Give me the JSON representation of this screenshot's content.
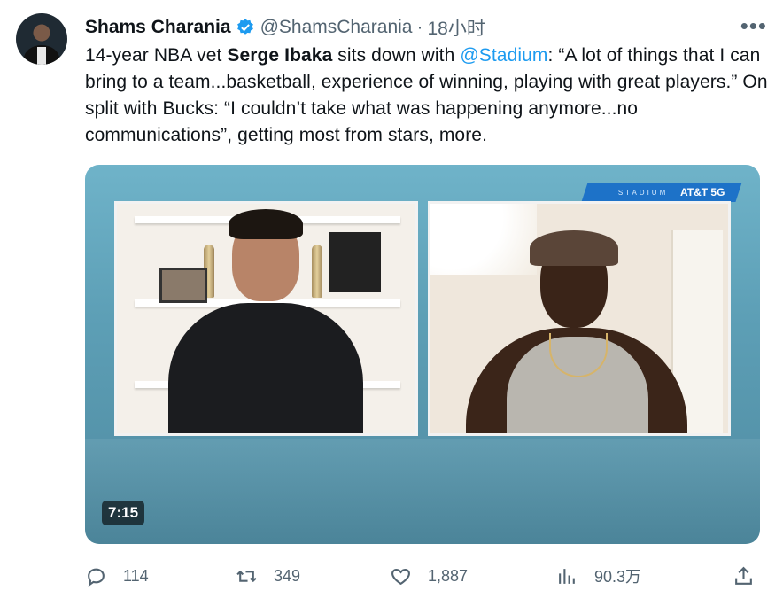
{
  "author": {
    "name": "Shams Charania",
    "handle": "@ShamsCharania",
    "separator": "·",
    "time": "18小时"
  },
  "tweet": {
    "part1": "14-year NBA vet ",
    "bold": "Serge Ibaka",
    "part2": " sits down with ",
    "mention": "@Stadium",
    "part3": ": “A lot of things that I can bring to a team...basketball, experience of winning, playing with great players.” On split with Bucks: “I couldn’t take what was happening anymore...no communications”, getting most from stars, more."
  },
  "video": {
    "brand_stadium": "STADIUM",
    "brand_att": "AT&T 5G",
    "duration": "7:15"
  },
  "actions": {
    "reply_count": "114",
    "retweet_count": "349",
    "like_count": "1,887",
    "views_count": "90.3万"
  },
  "colors": {
    "accent": "#1d9bf0",
    "secondary_text": "#536471"
  },
  "icons": [
    "verified-icon",
    "more-icon",
    "reply-icon",
    "retweet-icon",
    "like-icon",
    "views-icon",
    "share-icon"
  ]
}
